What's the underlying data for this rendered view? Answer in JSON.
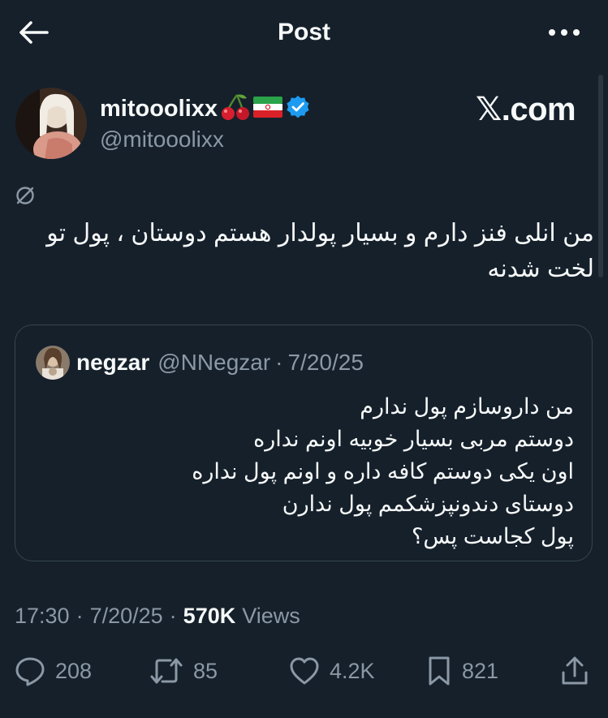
{
  "header": {
    "title": "Post",
    "back_icon": "arrow-left-icon",
    "more_icon": "more-horizontal-icon"
  },
  "author": {
    "display_name": "mitooolixx",
    "handle": "@mitooolixx",
    "badges": [
      "cherry-emoji",
      "iran-flag-emoji",
      "verified-badge-icon"
    ],
    "verified_color": "#1d9bf0"
  },
  "watermark": "𝕏.com",
  "post": {
    "status_icon": "no-sign-icon",
    "text": "من انلی فنز دارم و بسیار پولدار هستم دوستان ، پول تو\nلخت شدنه"
  },
  "quote": {
    "name": "negzar",
    "handle": "@NNegzar",
    "separator": "·",
    "date": "7/20/25",
    "text": "من داروسازم پول ندارم\nدوستم مربی بسیار خوبیه اونم نداره\nاون یکی دوستم کافه داره و اونم پول نداره\nدوستای دندونپزشکمم پول ندارن\nپول کجاست پس؟"
  },
  "meta": {
    "time": "17:30",
    "separator": "·",
    "date": "7/20/25",
    "views_count": "570K",
    "views_label": "Views"
  },
  "actions": {
    "replies": "208",
    "reposts": "85",
    "likes": "4.2K",
    "bookmarks": "821"
  },
  "colors": {
    "background": "#15202b",
    "text_primary": "#f7f9f9",
    "text_secondary": "#8b98a5",
    "border": "#38444d"
  }
}
